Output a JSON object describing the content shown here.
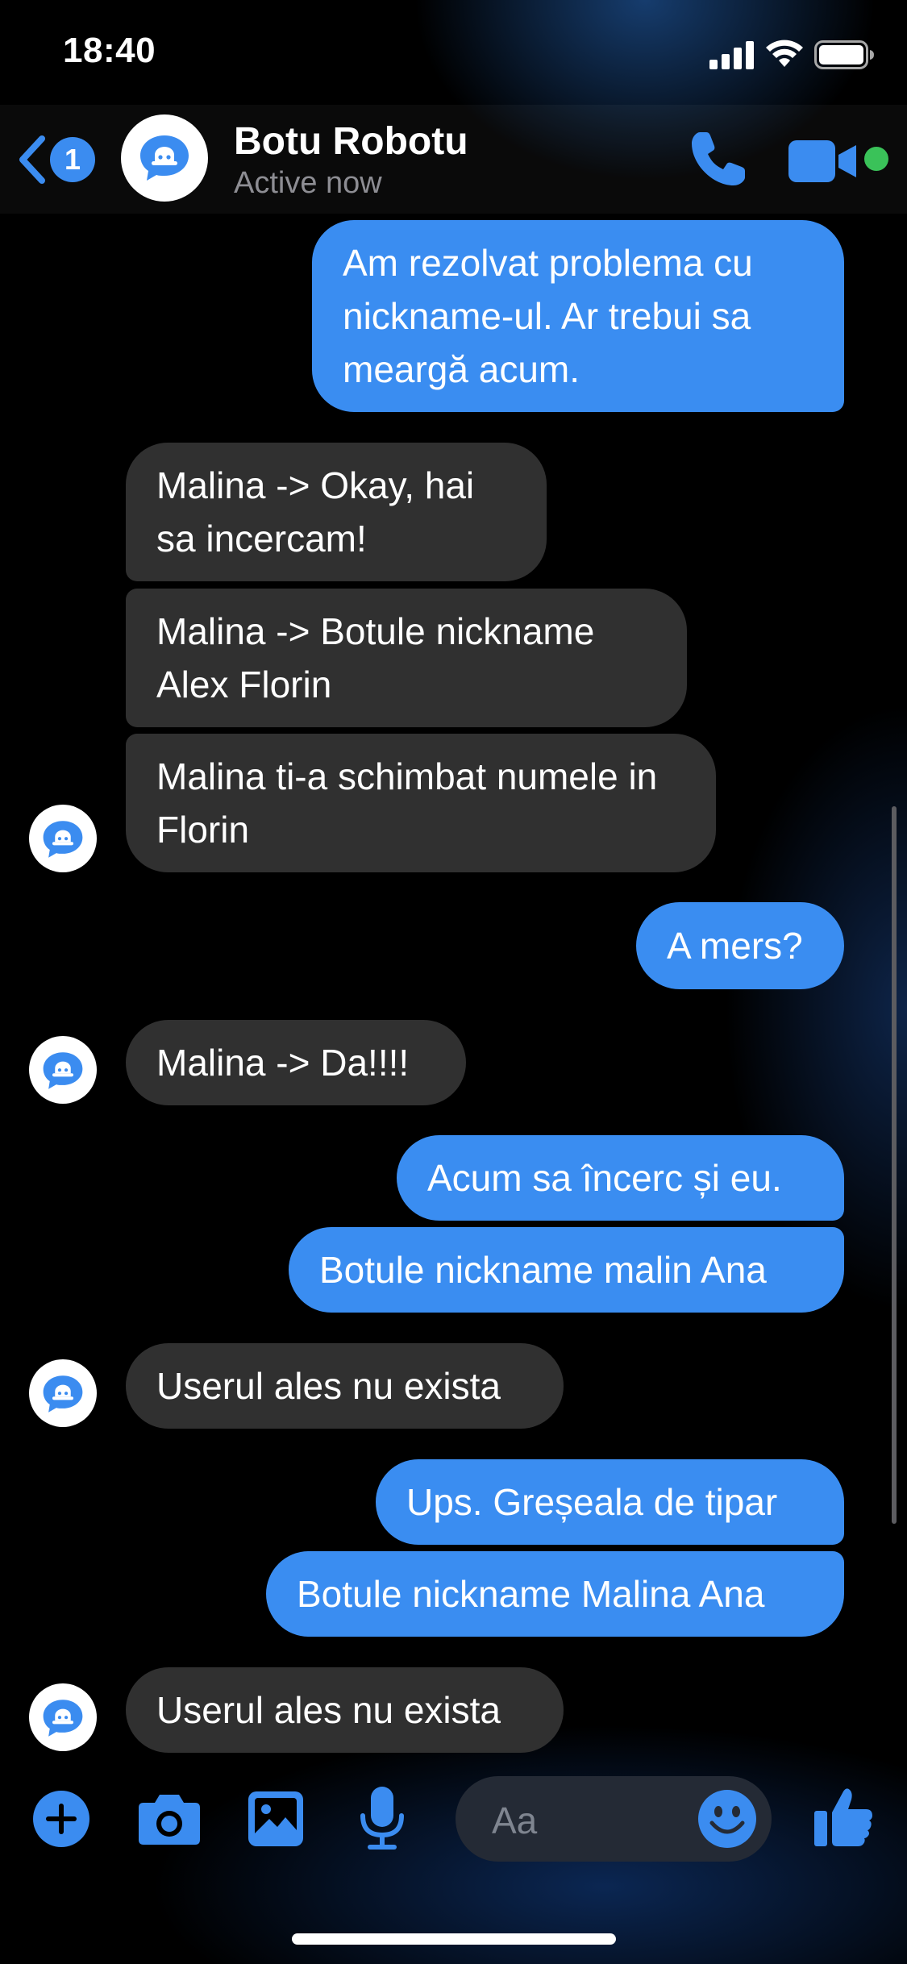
{
  "status_bar": {
    "time": "18:40",
    "signal": "signal-icon",
    "wifi": "wifi-icon",
    "battery": "battery-icon"
  },
  "header": {
    "unread_count": "1",
    "contact_name": "Botu Robotu",
    "contact_status": "Active now",
    "icons": [
      "back-chevron-icon",
      "bot-avatar-icon",
      "phone-icon",
      "video-camera-icon"
    ],
    "online_color": "#3ac259"
  },
  "messages": [
    {
      "id": "m1",
      "from": "me",
      "text": "Am rezolvat problema cu nickname-ul. Ar trebui sa meargă acum."
    },
    {
      "id": "m2",
      "from": "bot",
      "text": "Malina -> Okay, hai sa incercam!"
    },
    {
      "id": "m3",
      "from": "bot",
      "text": "Malina -> Botule nickname Alex Florin"
    },
    {
      "id": "m4",
      "from": "bot",
      "text": "Malina ti-a schimbat numele in Florin"
    },
    {
      "id": "m5",
      "from": "me",
      "text": "A mers?"
    },
    {
      "id": "m6",
      "from": "bot",
      "text": "Malina -> Da!!!!"
    },
    {
      "id": "m7",
      "from": "me",
      "text": "Acum sa încerc și eu."
    },
    {
      "id": "m8",
      "from": "me",
      "text": "Botule nickname malin Ana"
    },
    {
      "id": "m9",
      "from": "bot",
      "text": "Userul ales nu exista"
    },
    {
      "id": "m10",
      "from": "me",
      "text": "Ups. Greșeala de tipar"
    },
    {
      "id": "m11",
      "from": "me",
      "text": "Botule nickname Malina Ana"
    },
    {
      "id": "m12",
      "from": "bot",
      "text": "Userul ales nu exista"
    }
  ],
  "composer": {
    "placeholder": "Aa",
    "icons": [
      "plus-icon",
      "camera-icon",
      "gallery-icon",
      "microphone-icon",
      "emoji-icon",
      "thumbs-up-icon"
    ]
  },
  "colors": {
    "accent": "#3a8df1",
    "received_bubble": "#303030",
    "background": "#000000"
  }
}
